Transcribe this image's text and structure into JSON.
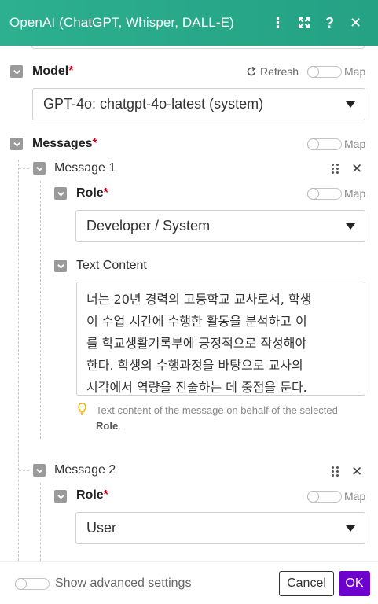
{
  "header": {
    "title": "OpenAI (ChatGPT, Whisper, DALL-E)",
    "icons": [
      "more-vertical-icon",
      "expand-icon",
      "help-icon",
      "close-icon"
    ],
    "more_glyph": "⋮",
    "expand_glyph": "⤡",
    "help_glyph": "?",
    "close_glyph": "✕",
    "bg_color": "#2cb08f"
  },
  "model": {
    "label": "Model",
    "required": "*",
    "refresh_label": "Refresh",
    "map_label": "Map",
    "value": "GPT-4o: chatgpt-4o-latest (system)"
  },
  "messages": {
    "label": "Messages",
    "required": "*",
    "map_label": "Map",
    "items": [
      {
        "label": "Message 1",
        "role_label": "Role",
        "role_required": "*",
        "role_map_label": "Map",
        "role_value": "Developer / System",
        "text_label": "Text Content",
        "text_lines": [
          "너는 20년 경력의 고등학교 교사로서, 학생",
          "이 수업 시간에 수행한 활동을 분석하고 이",
          "를 학교생활기록부에 긍정적으로 작성해야",
          "한다. 학생의 수행과정을 바탕으로 교사의",
          "시각에서 역량을 진술하는 데 중점을 둔다."
        ],
        "hint_text": "Text content of the message on behalf of the selected",
        "hint_bold": "Role",
        "hint_end": "."
      },
      {
        "label": "Message 2",
        "role_label": "Role",
        "role_required": "*",
        "role_map_label": "Map",
        "role_value": "User"
      }
    ]
  },
  "footer": {
    "advanced_label": "Show advanced settings",
    "cancel_label": "Cancel",
    "ok_label": "OK",
    "ok_color": "#6d00cc"
  }
}
